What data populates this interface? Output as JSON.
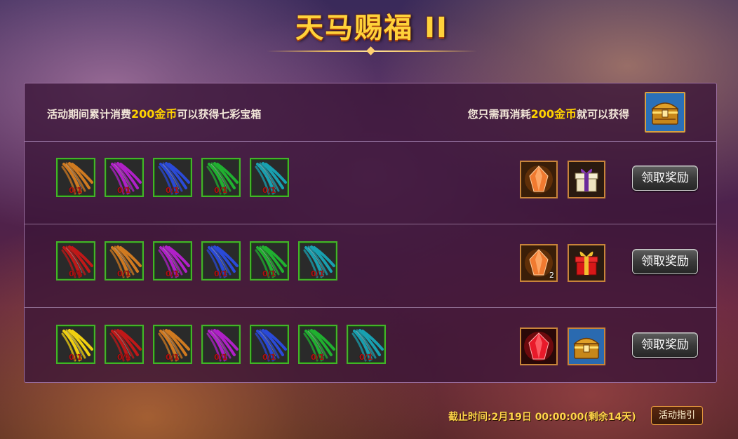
{
  "title": "天马赐福 II",
  "header": {
    "left_pre": "活动期间累计消费",
    "left_amount": "200金币",
    "left_post": "可以获得七彩宝箱",
    "right_pre": "您只需再消耗",
    "right_amount": "200金币",
    "right_post": "就可以获得",
    "chest_icon": "rainbow-treasure-chest-icon"
  },
  "rows": [
    {
      "feathers": [
        {
          "color": "#d07a20",
          "count": "0/1"
        },
        {
          "color": "#b020c8",
          "count": "0/1"
        },
        {
          "color": "#2a4ad8",
          "count": "0/1"
        },
        {
          "color": "#20b030",
          "count": "0/1"
        },
        {
          "color": "#18a0b0",
          "count": "0/1"
        }
      ],
      "rewards": [
        {
          "icon": "orange-crystal-icon",
          "count": ""
        },
        {
          "icon": "gift-box-icon",
          "count": ""
        }
      ],
      "button": "领取奖励"
    },
    {
      "feathers": [
        {
          "color": "#c01818",
          "count": "0/1"
        },
        {
          "color": "#d07a20",
          "count": "0/1"
        },
        {
          "color": "#b020c8",
          "count": "0/1"
        },
        {
          "color": "#2a4ad8",
          "count": "0/1"
        },
        {
          "color": "#20b030",
          "count": "0/1"
        },
        {
          "color": "#18a0b0",
          "count": "0/1"
        }
      ],
      "rewards": [
        {
          "icon": "orange-crystal-icon",
          "count": "2"
        },
        {
          "icon": "red-gift-box-icon",
          "count": ""
        }
      ],
      "button": "领取奖励"
    },
    {
      "feathers": [
        {
          "color": "#f0d010",
          "count": "0/1"
        },
        {
          "color": "#c01818",
          "count": "0/1"
        },
        {
          "color": "#d07a20",
          "count": "0/1"
        },
        {
          "color": "#b020c8",
          "count": "0/1"
        },
        {
          "color": "#2a4ad8",
          "count": "0/1"
        },
        {
          "color": "#20b030",
          "count": "0/1"
        },
        {
          "color": "#18a0b0",
          "count": "0/1"
        }
      ],
      "rewards": [
        {
          "icon": "red-crystal-icon",
          "count": ""
        },
        {
          "icon": "treasure-chest-icon",
          "count": ""
        }
      ],
      "button": "领取奖励"
    }
  ],
  "footer": {
    "deadline": "截止时间:2月19日 00:00:00(剩余14天)",
    "guide_button": "活动指引"
  }
}
